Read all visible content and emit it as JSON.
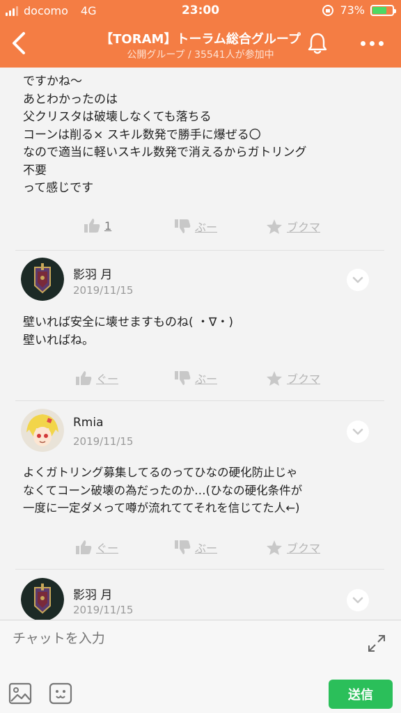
{
  "status_bar": {
    "carrier": "docomo",
    "network": "4G",
    "time": "23:00",
    "battery": "73%",
    "battery_level": 0.73
  },
  "header": {
    "title": "【TORAM】トーラム総合グループ",
    "subtitle": "公開グループ / 35541人が参加中"
  },
  "reaction_labels": {
    "dislike": "ぶー",
    "bookmark": "ブクマ",
    "like_default": "ぐー"
  },
  "messages": [
    {
      "text": "ですかね〜\nあとわかったのは\n父クリスタは破壊しなくても落ちる\nコーンは削る× スキル数発で勝手に爆ぜる〇\nなので適当に軽いスキル数発で消えるからガトリング\n不要\nって感じです",
      "like_count": "1"
    },
    {
      "user": "影羽 月",
      "date": "2019/11/15",
      "text": "壁いれば安全に壊せますものね( ・∇・)\n壁いればね。"
    },
    {
      "user": "Rmia",
      "date": "2019/11/15",
      "text": "よくガトリング募集してるのってひなの硬化防止じゃ\nなくてコーン破壊の為だったのか…(ひなの硬化条件が\n一度に一定ダメって噂が流れててそれを信じてた人←)"
    },
    {
      "user": "影羽 月",
      "date": "2019/11/15"
    }
  ],
  "input": {
    "placeholder": "チャットを入力",
    "send_label": "送信"
  },
  "colors": {
    "brand": "#f47d44",
    "send": "#2bbf5a"
  }
}
